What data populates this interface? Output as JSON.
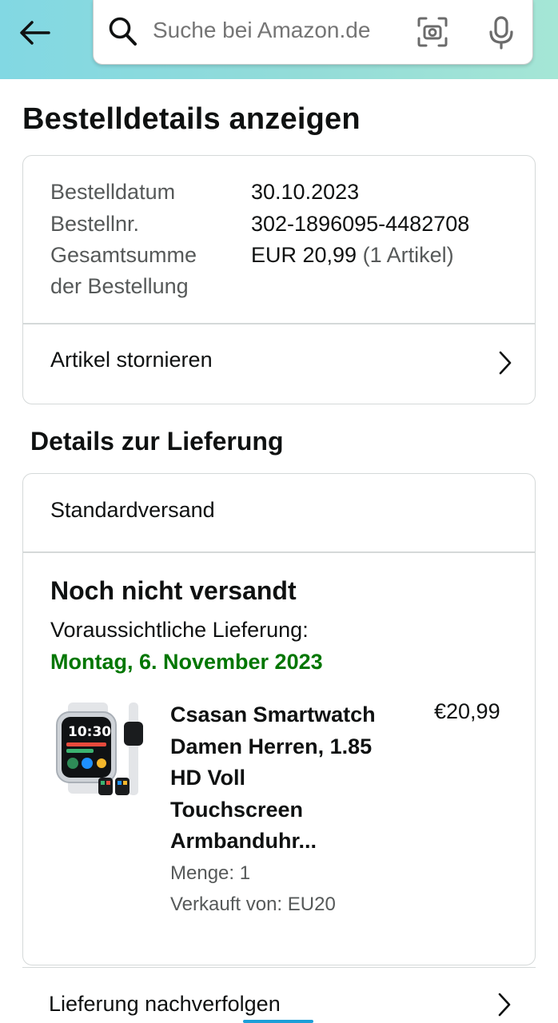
{
  "header": {
    "search_placeholder": "Suche bei Amazon.de",
    "icons": [
      "back-arrow-icon",
      "search-icon",
      "camera-icon",
      "microphone-icon"
    ]
  },
  "page": {
    "title": "Bestelldetails anzeigen"
  },
  "order": {
    "date_label": "Bestelldatum",
    "date_value": "30.10.2023",
    "number_label": "Bestellnr.",
    "number_value": "302-1896095-4482708",
    "total_label_line1": "Gesamtsumme",
    "total_label_line2": "der Bestellung",
    "total_value": "EUR 20,99",
    "total_items": "(1 Artikel)",
    "cancel_label": "Artikel stornieren"
  },
  "delivery": {
    "section_title": "Details zur Lieferung",
    "shipping_method": "Standardversand",
    "status": "Noch nicht versandt",
    "eta_label": "Voraussichtliche Lieferung:",
    "eta_date": "Montag, 6. November 2023",
    "eta_color": "#007600",
    "item": {
      "title_lines": [
        "Csasan Smartwatch",
        "Damen Herren, 1.85",
        "HD Voll",
        "Touchscreen",
        "Armbanduhr..."
      ],
      "price": "€20,99",
      "quantity": "Menge: 1",
      "seller": "Verkauft von: EU20"
    },
    "track_label": "Lieferung nachverfolgen"
  }
}
